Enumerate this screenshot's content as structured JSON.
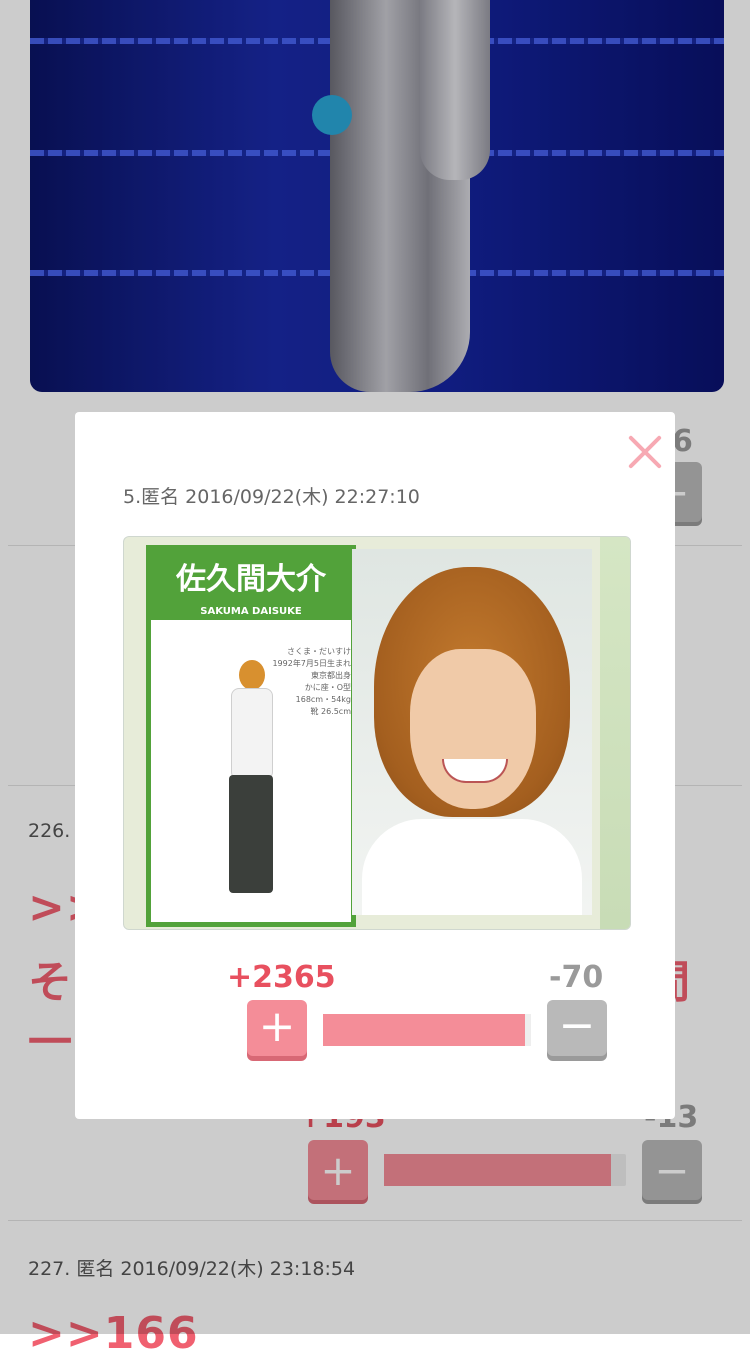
{
  "background": {
    "comment_top": {
      "minus_count_partial": "6"
    },
    "comment_226": {
      "meta": "226.",
      "reply_lines": [
        ">>",
        "そ",
        "一"
      ],
      "reply_right_partial": "間",
      "plus_count_partial": "+193",
      "minus_count": "-13",
      "bar_ratio": 0.937
    },
    "comment_227": {
      "meta": "227. 匿名 2016/09/22(木) 23:18:54",
      "reply": ">>166"
    }
  },
  "modal": {
    "meta": "5.匿名 2016/09/22(木) 22:27:10",
    "image": {
      "name_jp": "佐久間大介",
      "name_romaji": "SAKUMA DAISUKE",
      "profile_lines": [
        "さくま・だいすけ",
        "1992年7月5日生まれ",
        "東京都出身",
        "かに座・O型",
        "168cm・54kg",
        "靴 26.5cm"
      ]
    },
    "votes": {
      "plus": "+2365",
      "minus": "-70",
      "plus_label": "+",
      "minus_label": "−",
      "ratio": 0.971
    }
  },
  "colors": {
    "accent": "#f48d98",
    "plus_text": "#e8505f",
    "minus": "#b9b9b9",
    "close": "#f7a9b3"
  }
}
